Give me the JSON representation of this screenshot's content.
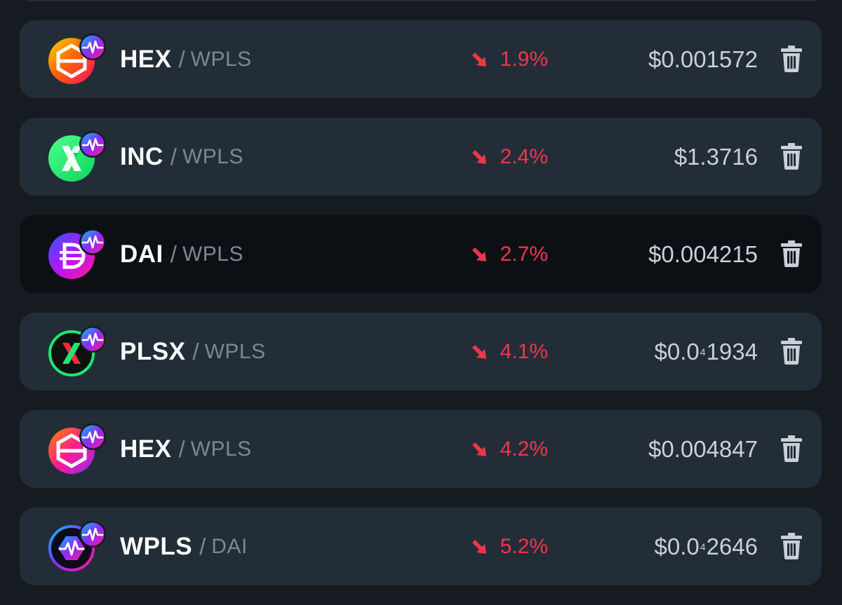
{
  "colors": {
    "row_background": "#222d38",
    "row_highlight_background": "#0c1014",
    "change_negative": "#f0364a",
    "price_text": "#c9d0d8",
    "quote_text": "#7c8795"
  },
  "chain_badge_icon": "pulse-heartbeat-icon",
  "delete_icon": "trash-icon",
  "rows": [
    {
      "base": "HEX",
      "separator": "/",
      "quote": "WPLS",
      "change": "1.9%",
      "price": "$0.001572",
      "price_prefix": "",
      "price_sub": "",
      "price_suffix": "",
      "logo_icon": "hex-logo-icon"
    },
    {
      "base": "INC",
      "separator": "/",
      "quote": "WPLS",
      "change": "2.4%",
      "price": "$1.3716",
      "price_prefix": "",
      "price_sub": "",
      "price_suffix": "",
      "logo_icon": "inc-logo-icon"
    },
    {
      "base": "DAI",
      "separator": "/",
      "quote": "WPLS",
      "change": "2.7%",
      "price": "$0.004215",
      "price_prefix": "",
      "price_sub": "",
      "price_suffix": "",
      "logo_icon": "dai-logo-icon"
    },
    {
      "base": "PLSX",
      "separator": "/",
      "quote": "WPLS",
      "change": "4.1%",
      "price": "",
      "price_prefix": "$0.0",
      "price_sub": "4",
      "price_suffix": "1934",
      "logo_icon": "plsx-logo-icon"
    },
    {
      "base": "HEX",
      "separator": "/",
      "quote": "WPLS",
      "change": "4.2%",
      "price": "$0.004847",
      "price_prefix": "",
      "price_sub": "",
      "price_suffix": "",
      "logo_icon": "hex-logo-icon"
    },
    {
      "base": "WPLS",
      "separator": "/",
      "quote": "DAI",
      "change": "5.2%",
      "price": "",
      "price_prefix": "$0.0",
      "price_sub": "4",
      "price_suffix": "2646",
      "logo_icon": "wpls-logo-icon"
    }
  ]
}
